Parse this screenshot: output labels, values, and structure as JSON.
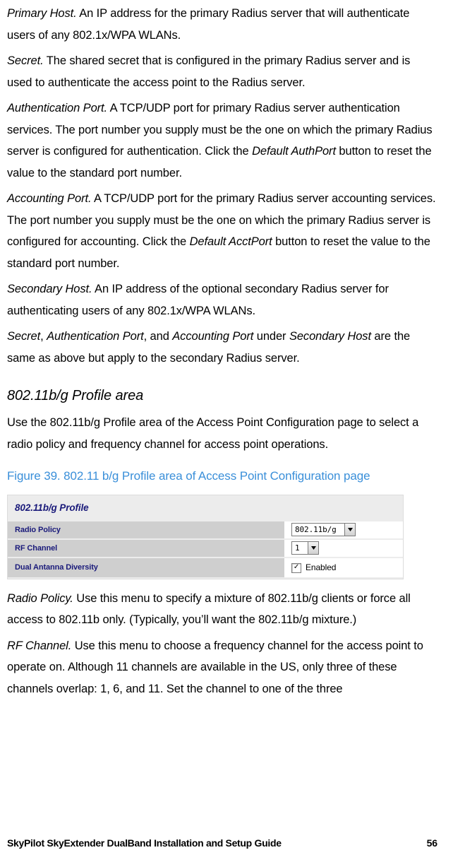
{
  "terms": {
    "primary_host": "Primary Host.",
    "secret": "Secret.",
    "auth_port": "Authentication Port.",
    "acct_port": "Accounting Port.",
    "secondary_host": "Secondary Host.",
    "secret_plain": "Secret",
    "auth_port_plain": "Authentication Port",
    "acct_port_plain": "Accounting Port",
    "secondary_host_plain": "Secondary Host",
    "default_authport": "Default AuthPort",
    "default_acctport": "Default AcctPort",
    "radio_policy": "Radio Policy.",
    "rf_channel": "RF Channel."
  },
  "body": {
    "primary_host": " An IP address for the primary Radius server that will authenticate users of any 802.1x/WPA WLANs.",
    "secret": " The shared secret that is configured in the primary Radius server and is used to authenticate the access point to the Radius server.",
    "auth_port_a": " A TCP/UDP port for primary Radius server authentication services. The port number you supply must be the one on which the primary Radius server is configured for authentication. Click the ",
    "auth_port_b": " button to reset the value to the standard port number.",
    "acct_port_a": " A TCP/UDP port for the primary Radius server accounting services. The port number you supply must be the one on which the primary Radius server is configured for accounting. Click the ",
    "acct_port_b": " button to reset the value to the standard port number.",
    "secondary_host": " An IP address of the optional secondary Radius server for authenticating users of any 802.1x/WPA WLANs.",
    "sep_comma": ", ",
    "sep_and": ", and ",
    "sep_under": " under ",
    "secondary_line_tail": " are the same as above but apply to the secondary Radius server.",
    "h3": "802.11b/g Profile area",
    "h3_para": "Use the 802.11b/g Profile area of the Access Point Configuration page to select a radio policy and frequency channel for access point operations.",
    "figcap": "Figure 39. 802.11 b/g Profile area of Access Point Configuration page",
    "radio_policy": " Use this menu to specify a mixture of 802.11b/g clients or force all access to 802.11b only. (Typically, you’ll want the 802.11b/g mixture.)",
    "rf_channel": " Use this menu to choose a frequency channel for the access point to operate on. Although 11 channels are available in the US, only three of these channels overlap: 1, 6, and 11. Set the channel to one of the three"
  },
  "panel": {
    "title": "802.11b/g Profile",
    "rows": [
      {
        "label": "Radio Policy",
        "value": "802.11b/g",
        "kind": "select",
        "width": 86
      },
      {
        "label": "RF Channel",
        "value": "1",
        "kind": "select",
        "width": 20
      },
      {
        "label": "Dual Antanna Diversity",
        "value": "Enabled",
        "kind": "check",
        "checked": true
      }
    ]
  },
  "footer": {
    "title": "SkyPilot SkyExtender DualBand Installation and Setup Guide",
    "page": "56"
  }
}
